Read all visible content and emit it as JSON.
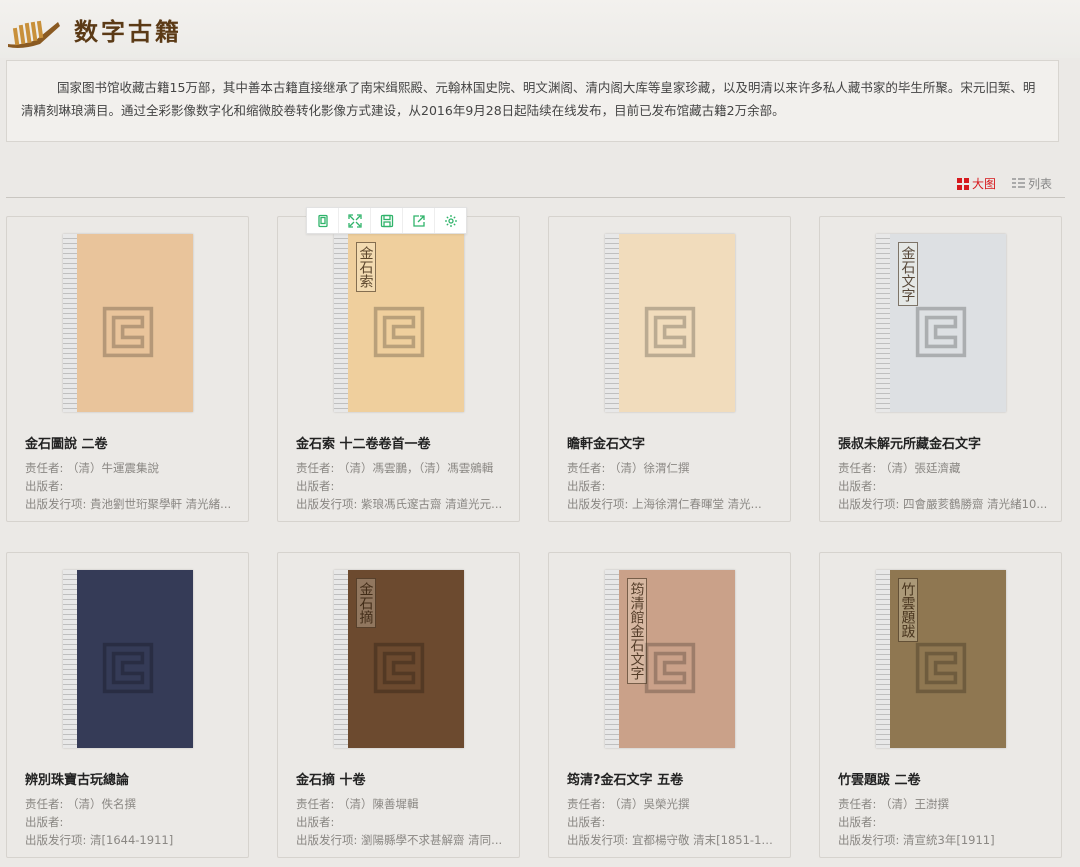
{
  "header": {
    "title": "数字古籍"
  },
  "intro": "国家图书馆收藏古籍15万部，其中善本古籍直接继承了南宋缉熙殿、元翰林国史院、明文渊阁、清内阁大库等皇家珍藏，以及明清以来许多私人藏书家的毕生所聚。宋元旧椠、明清精刻琳琅满目。通过全彩影像数字化和缩微胶卷转化影像方式建设，从2016年9月28日起陆续在线发布，目前已发布馆藏古籍2万余部。",
  "view_toggle": {
    "large": "大图",
    "list": "列表"
  },
  "toolbar": [
    "read-icon",
    "fullscreen-icon",
    "save-icon",
    "share-icon",
    "settings-icon"
  ],
  "books": [
    {
      "title": "金石圖說 二卷",
      "author": "责任者: （清）牛運震集說",
      "publisher": "出版者:",
      "edition": "出版发行项: 貴池劉世珩聚學軒 清光緒...",
      "cover_color": "#e9c49b"
    },
    {
      "title": "金石索 十二卷卷首一卷",
      "author": "责任者: （清）馮雲鵬，（清）馮雲鵷輯",
      "publisher": "出版者:",
      "edition": "出版发行项: 紫琅馮氏邃古齋 清道光元...",
      "cover_color": "#efcf9d",
      "slip": "金石索"
    },
    {
      "title": "瞻軒金石文字",
      "author": "责任者: （清）徐渭仁撰",
      "publisher": "出版者:",
      "edition": "出版发行项: 上海徐渭仁春暉堂 清光...",
      "cover_color": "#f1dcbc"
    },
    {
      "title": "張叔未解元所藏金石文字",
      "author": "责任者: （清）張廷濟藏",
      "publisher": "出版者:",
      "edition": "出版发行项: 四會嚴荄鶴勝齋 清光緒10...",
      "cover_color": "#dde0e3",
      "slip": "金石文字"
    },
    {
      "title": "辨別珠寶古玩總論",
      "author": "责任者: （清）佚名撰",
      "publisher": "出版者:",
      "edition": "出版发行项: 清[1644-1911]",
      "cover_color": "#353b57"
    },
    {
      "title": "金石摘 十卷",
      "author": "责任者: （清）陳善墀輯",
      "publisher": "出版者:",
      "edition": "出版发行项: 瀏陽縣學不求甚解齋 清同...",
      "cover_color": "#6c4a2f",
      "slip": "金石摘"
    },
    {
      "title": "筠清?金石文字 五卷",
      "author": "责任者: （清）吳榮光撰",
      "publisher": "出版者:",
      "edition": "出版发行项: 宜都楊守敬 清末[1851-19...",
      "cover_color": "#caa189",
      "slip": "筠清館金石文字"
    },
    {
      "title": "竹雲題跋 二卷",
      "author": "责任者: （清）王澍撰",
      "publisher": "出版者:",
      "edition": "出版发行项: 清宣統3年[1911]",
      "cover_color": "#8f7751",
      "slip": "竹雲題跋"
    }
  ]
}
